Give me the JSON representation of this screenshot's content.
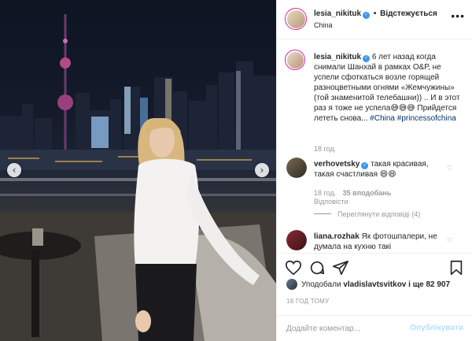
{
  "post": {
    "username": "lesia_nikituk",
    "follow_status": "Відстежується",
    "location": "China",
    "verified": true
  },
  "caption": {
    "username": "lesia_nikituk",
    "text": "6 лет назад когда снимали Шанхай в рамках О&Р, не успели сфоткаться возле горящей разноцветными огнями «Жемчужины» (той знаменитой телебашни)) .. И в этот раз я тоже не успела",
    "emoji": "😅😅😅",
    "text2": "Прийдется лететь снова...",
    "tags": [
      "#China",
      "#princessofchina"
    ],
    "time": "18 год."
  },
  "comments": [
    {
      "username": "verhovetsky",
      "verified": true,
      "text": "такая красивая, такая счастливая",
      "emoji": "😄😄",
      "time": "18 год.",
      "likes": "35 вподобань",
      "reply": "Відповісти",
      "view_replies": "Переглянути відповіді (4)"
    },
    {
      "username": "liana.rozhak",
      "text": "Як фотошпалери, не думала на кухню такі"
    }
  ],
  "likes": {
    "prefix": "Уподобали",
    "user": "vladislavtsvitkov",
    "suffix": "і ще 82 907"
  },
  "timestamp": "18 ГОД ТОМУ",
  "add_comment": {
    "placeholder": "Додайте коментар...",
    "publish": "Опублікувати"
  },
  "icons": {
    "heart": "heart-icon",
    "comment": "comment-icon",
    "share": "share-icon",
    "save": "bookmark-icon",
    "more": "more-icon"
  },
  "colors": {
    "link": "#003569",
    "verified": "#3897f0",
    "muted": "#999999",
    "publish": "#b2dffc"
  }
}
